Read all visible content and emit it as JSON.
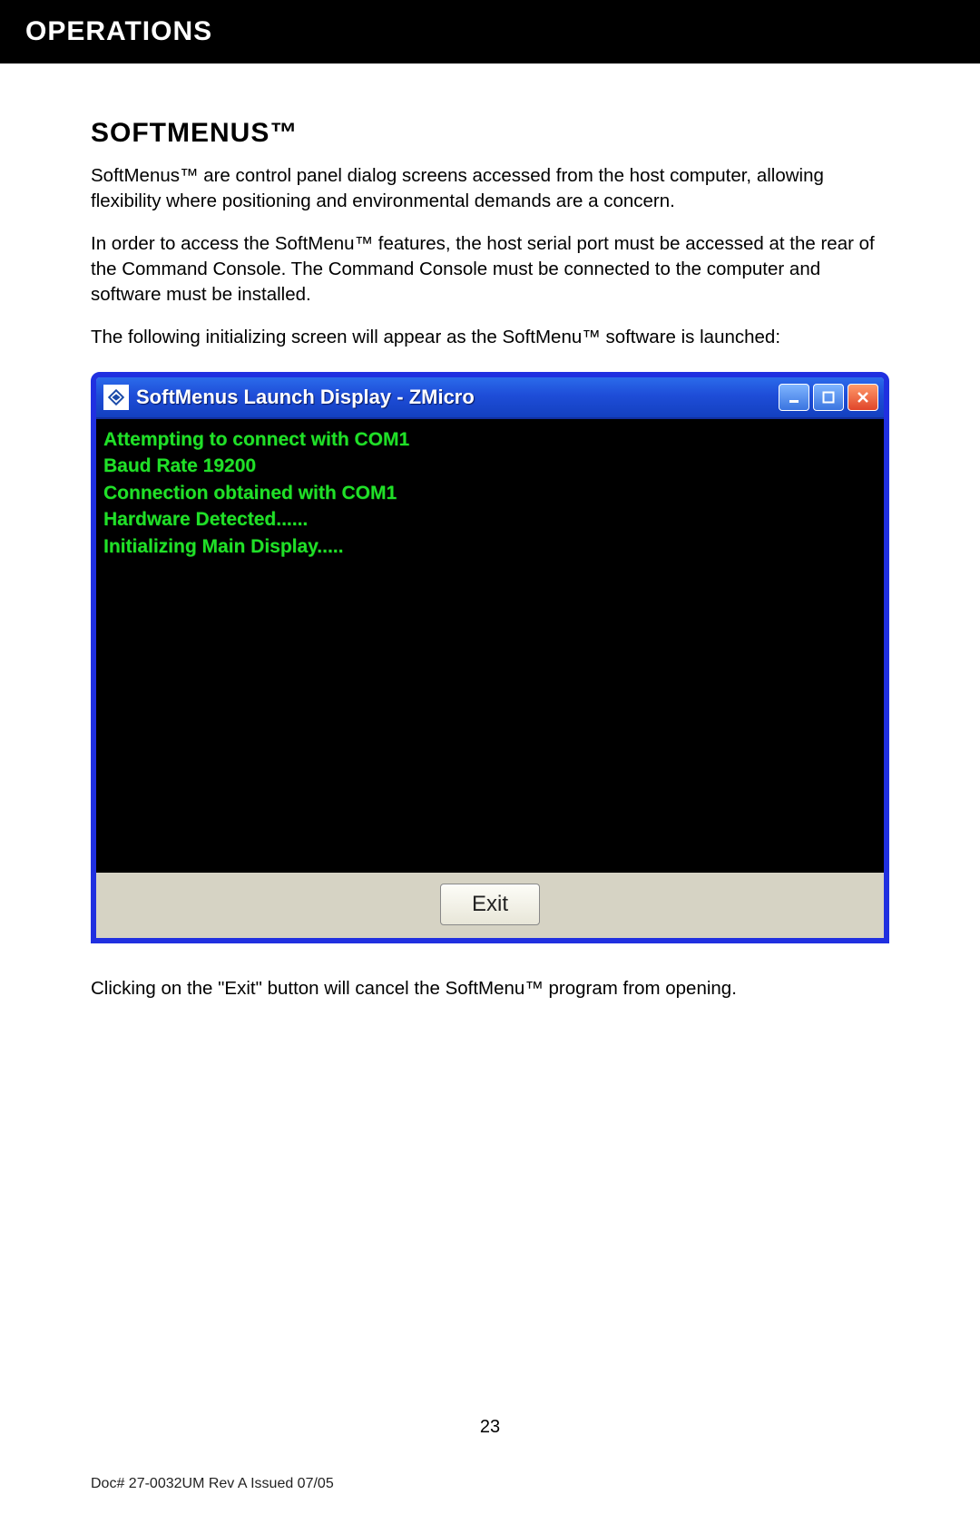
{
  "header": {
    "title": "OPERATIONS"
  },
  "section": {
    "title": "SOFTMENUS™"
  },
  "paragraphs": {
    "p1": "SoftMenus™  are control panel dialog screens accessed from the host computer, allowing flexibility where positioning and environmental demands are a concern.",
    "p2": "In order to access the SoftMenu™ features, the host serial port must be accessed at the rear of the Command Console. The Command Console must be connected to the computer and software must be installed.",
    "p3": "The following initializing screen will appear as the SoftMenu™ software is launched:",
    "p4": "Clicking on the \"Exit\" button will cancel the SoftMenu™ program from opening."
  },
  "window": {
    "title": "SoftMenus Launch Display - ZMicro",
    "console_lines": [
      "Attempting to connect with COM1",
      "Baud Rate 19200",
      "Connection obtained with COM1",
      "Hardware Detected......",
      "Initializing Main Display....."
    ],
    "exit_label": "Exit"
  },
  "footer": {
    "page_number": "23",
    "doc_id": "Doc# 27-0032UM Rev A Issued 07/05"
  }
}
